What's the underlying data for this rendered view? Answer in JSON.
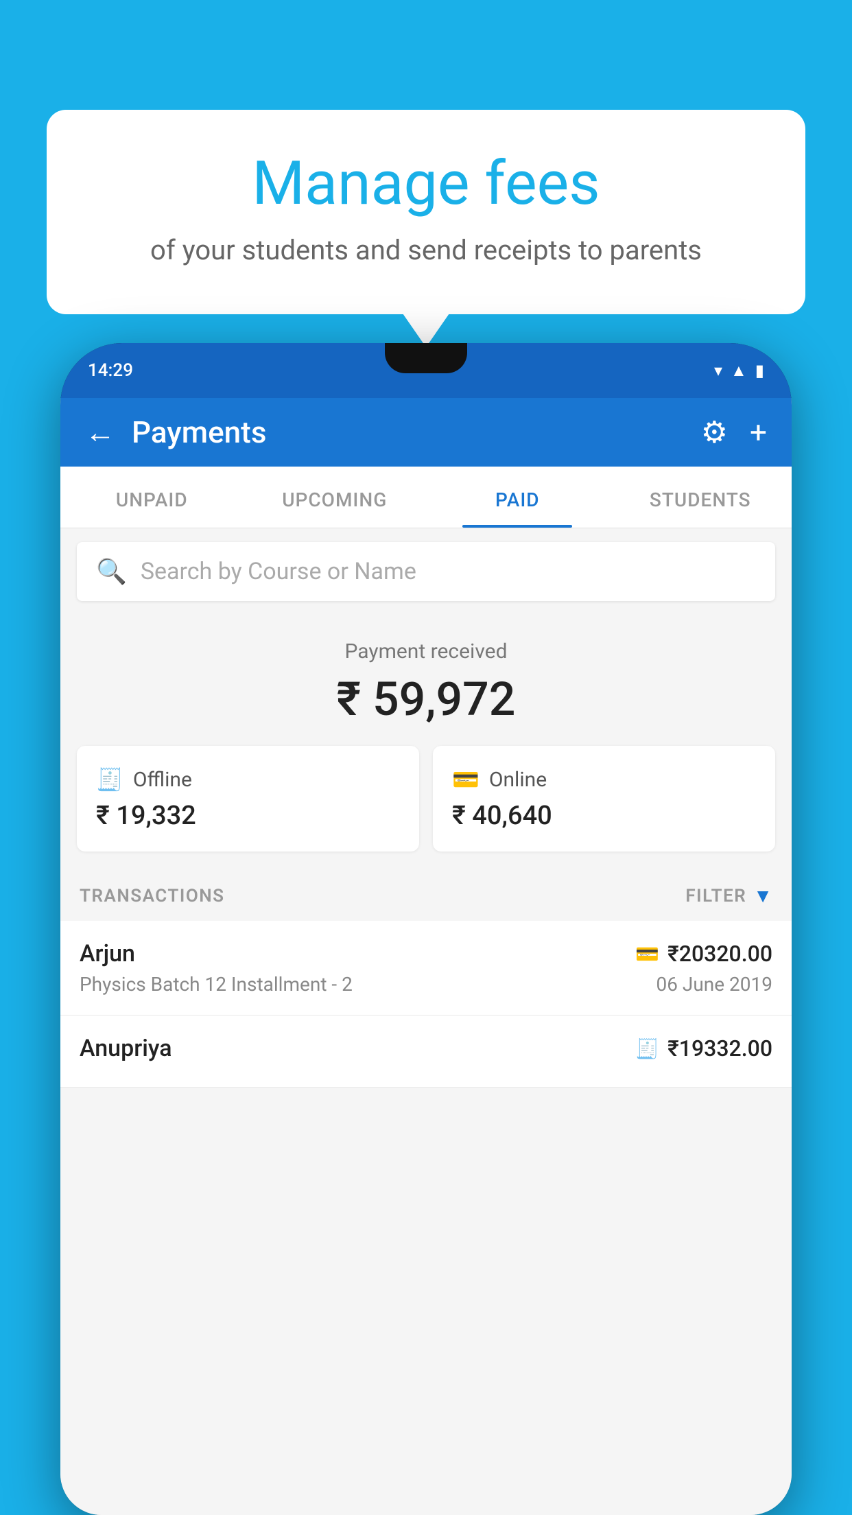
{
  "background_color": "#1ab0e8",
  "bubble": {
    "title": "Manage fees",
    "subtitle": "of your students and send receipts to parents"
  },
  "phone": {
    "status_bar": {
      "time": "14:29"
    },
    "header": {
      "title": "Payments",
      "back_label": "←",
      "settings_label": "⚙",
      "add_label": "+"
    },
    "tabs": [
      {
        "label": "UNPAID",
        "active": false
      },
      {
        "label": "UPCOMING",
        "active": false
      },
      {
        "label": "PAID",
        "active": true
      },
      {
        "label": "STUDENTS",
        "active": false
      }
    ],
    "search": {
      "placeholder": "Search by Course or Name"
    },
    "payment_received": {
      "label": "Payment received",
      "amount": "₹ 59,972"
    },
    "cards": [
      {
        "type": "Offline",
        "amount": "₹ 19,332",
        "icon": "offline"
      },
      {
        "type": "Online",
        "amount": "₹ 40,640",
        "icon": "online"
      }
    ],
    "transactions_label": "TRANSACTIONS",
    "filter_label": "FILTER",
    "transactions": [
      {
        "name": "Arjun",
        "course": "Physics Batch 12 Installment - 2",
        "amount": "₹20320.00",
        "date": "06 June 2019",
        "payment_type": "online"
      },
      {
        "name": "Anupriya",
        "course": "",
        "amount": "₹19332.00",
        "date": "",
        "payment_type": "offline"
      }
    ]
  }
}
